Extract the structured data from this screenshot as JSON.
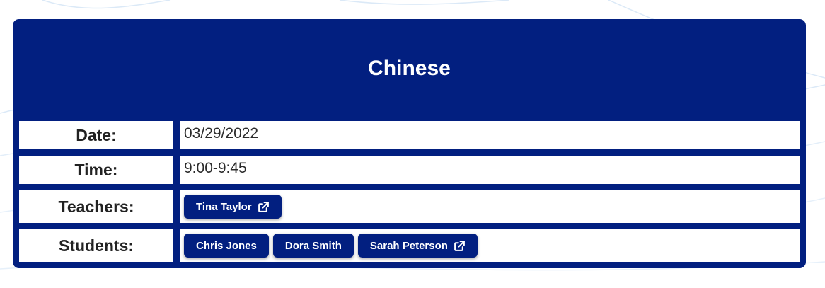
{
  "lesson": {
    "title": "Chinese",
    "rows": {
      "date": {
        "label": "Date:",
        "value": "03/29/2022"
      },
      "time": {
        "label": "Time:",
        "value": "9:00-9:45"
      },
      "teachers": {
        "label": "Teachers:",
        "chips": [
          {
            "name": "Tina Taylor",
            "icon": "external-link-icon"
          }
        ]
      },
      "students": {
        "label": "Students:",
        "chips": [
          {
            "name": "Chris Jones",
            "icon": ""
          },
          {
            "name": "Dora Smith",
            "icon": ""
          },
          {
            "name": "Sarah Peterson",
            "icon": "external-link-icon"
          }
        ]
      }
    }
  },
  "colors": {
    "primary": "#021f80",
    "background": "#ffffff",
    "label_text": "#222222"
  }
}
